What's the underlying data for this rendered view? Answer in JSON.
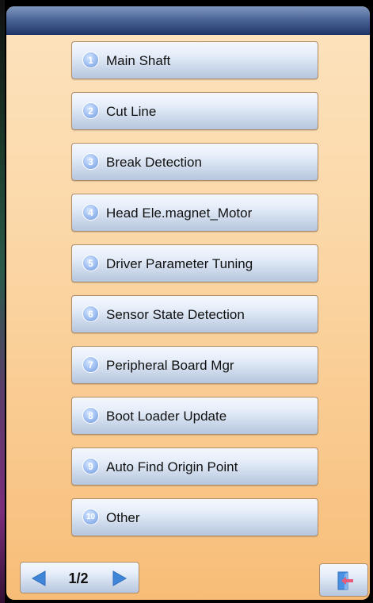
{
  "header": {
    "title": ""
  },
  "menu": {
    "items": [
      {
        "number": "1",
        "label": "Main Shaft"
      },
      {
        "number": "2",
        "label": "Cut Line"
      },
      {
        "number": "3",
        "label": "Break Detection"
      },
      {
        "number": "4",
        "label": "Head Ele.magnet_Motor"
      },
      {
        "number": "5",
        "label": "Driver Parameter Tuning"
      },
      {
        "number": "6",
        "label": "Sensor State Detection"
      },
      {
        "number": "7",
        "label": "Peripheral Board Mgr"
      },
      {
        "number": "8",
        "label": "Boot Loader Update"
      },
      {
        "number": "9",
        "label": "Auto Find Origin Point"
      },
      {
        "number": "10",
        "label": "Other"
      }
    ]
  },
  "pager": {
    "page_text": "1/2",
    "prev_icon": "left-arrow-icon",
    "next_icon": "right-arrow-icon"
  },
  "exit": {
    "icon": "exit-door-icon"
  },
  "colors": {
    "title_bar": "#3a5488",
    "panel_top": "#fde3bf",
    "panel_bottom": "#f7bd77",
    "button_top": "#f4f8fd",
    "button_bottom": "#b6c6de",
    "badge": "#8fb1ea",
    "arrow": "#3f86d9",
    "exit_arrow": "#e85a7a"
  }
}
